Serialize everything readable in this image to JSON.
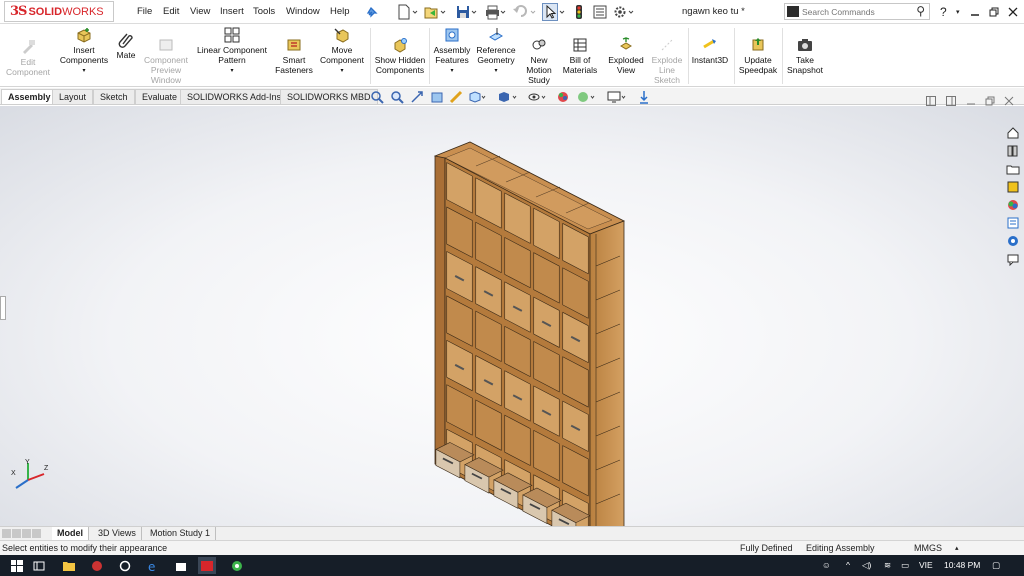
{
  "app": {
    "logo_brand": "3S",
    "logo_solid": "SOLID",
    "logo_works": "WORKS",
    "document_title": "ngawn keo tu *"
  },
  "menu": [
    "File",
    "Edit",
    "View",
    "Insert",
    "Tools",
    "Window",
    "Help"
  ],
  "search": {
    "placeholder": "Search Commands"
  },
  "command_manager": {
    "buttons": [
      {
        "name": "edit-component",
        "label": "Edit Component",
        "disabled": true
      },
      {
        "name": "insert-components",
        "label": "Insert Components",
        "disabled": false
      },
      {
        "name": "mate",
        "label": "Mate",
        "disabled": false
      },
      {
        "name": "component-preview-window",
        "label": "Component Preview Window",
        "disabled": true
      },
      {
        "name": "linear-component-pattern",
        "label": "Linear Component Pattern",
        "disabled": false
      },
      {
        "name": "smart-fasteners",
        "label": "Smart Fasteners",
        "disabled": false
      },
      {
        "name": "move-component",
        "label": "Move Component",
        "disabled": false
      },
      {
        "name": "show-hidden-components",
        "label": "Show Hidden Components",
        "disabled": false
      },
      {
        "name": "assembly-features",
        "label": "Assembly Features",
        "disabled": false
      },
      {
        "name": "reference-geometry",
        "label": "Reference Geometry",
        "disabled": false
      },
      {
        "name": "new-motion-study",
        "label": "New Motion Study",
        "disabled": false
      },
      {
        "name": "bill-of-materials",
        "label": "Bill of Materials",
        "disabled": false
      },
      {
        "name": "exploded-view",
        "label": "Exploded View",
        "disabled": false
      },
      {
        "name": "explode-line-sketch",
        "label": "Explode Line Sketch",
        "disabled": true
      },
      {
        "name": "instant3d",
        "label": "Instant3D",
        "disabled": false
      },
      {
        "name": "update-speedpak",
        "label": "Update Speedpak",
        "disabled": false
      },
      {
        "name": "take-snapshot",
        "label": "Take Snapshot",
        "disabled": false
      }
    ]
  },
  "tabs": [
    "Assembly",
    "Layout",
    "Sketch",
    "Evaluate",
    "SOLIDWORKS Add-Ins",
    "SOLIDWORKS MBD"
  ],
  "active_tab": "Assembly",
  "triad": {
    "x": "X",
    "y": "Y",
    "z": "Z"
  },
  "bottom_tabs": [
    "Model",
    "3D Views",
    "Motion Study 1"
  ],
  "status": {
    "hint": "Select entities to modify their appearance",
    "definition": "Fully Defined",
    "mode": "Editing Assembly",
    "units": "MMGS",
    "units_caret": "▴"
  },
  "taskbar": {
    "language": "VIE",
    "clock": "10:48 PM"
  },
  "colors": {
    "brand": "#d8262b",
    "wood": "#c9955a",
    "accent": "#1a73c9"
  }
}
